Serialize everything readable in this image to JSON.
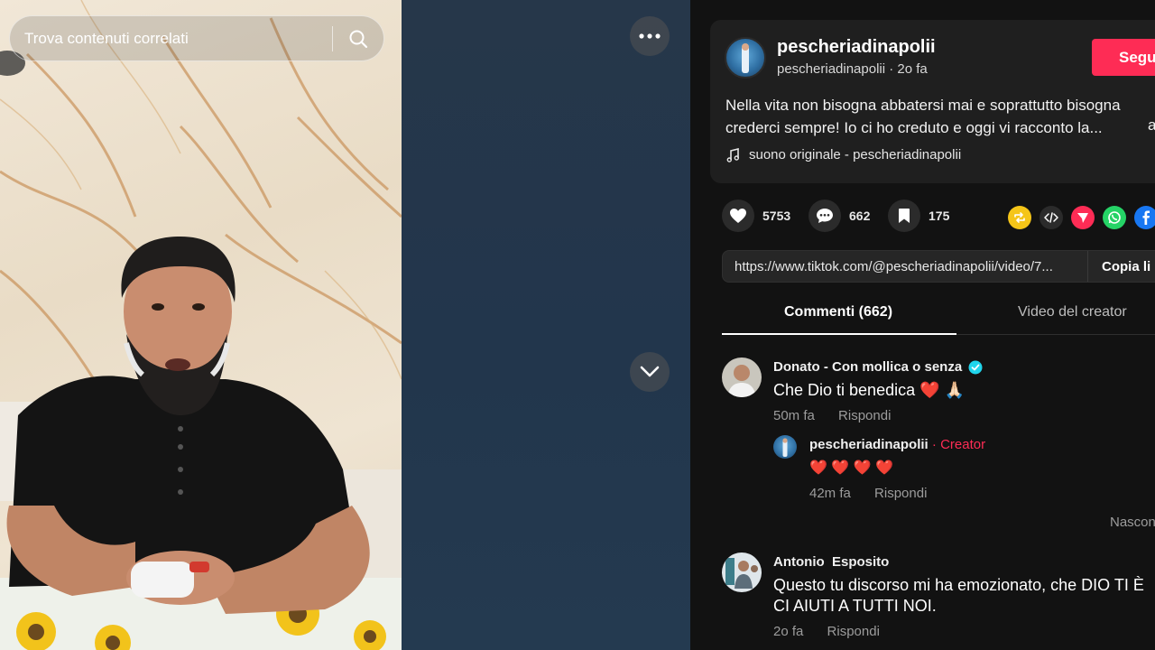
{
  "search": {
    "placeholder": "Trova contenuti correlati"
  },
  "post": {
    "author_name": "pescheriadinapolii",
    "author_sub": "pescheriadinapolii · 2o fa",
    "follow_label": "Segui",
    "description_line1": "Nella vita non bisogna abbatersi mai e soprattutto bisogna",
    "description_line2": "crederci sempre! Io ci ho creduto e oggi vi racconto la...",
    "description_more": "a",
    "music": "suono originale - pescheriadinapolii"
  },
  "actions": {
    "likes": "5753",
    "comments": "662",
    "saves": "175"
  },
  "share_colors": {
    "repost": "#f5c518",
    "embed": "#2b2b2b",
    "send": "#fe2c55",
    "whatsapp": "#25d366",
    "facebook": "#1877f2"
  },
  "link": {
    "url": "https://www.tiktok.com/@pescheriadinapolii/video/7...",
    "copy_label": "Copia li"
  },
  "tabs": {
    "comments": "Commenti (662)",
    "creator_videos": "Video del creator"
  },
  "comments": [
    {
      "user": "Donato - Con mollica o senza",
      "text": "Che Dio ti benedica ❤️ 🙏🏻",
      "time": "50m fa",
      "reply_label": "Rispondi"
    },
    {
      "user": "Antonio  Esposito",
      "text_line1": "Questo tu discorso mi ha emozionato, che DIO TI È",
      "text_line2": "CI AIUTI A TUTTI NOI.",
      "time": "2o fa",
      "reply_label": "Rispondi"
    }
  ],
  "reply": {
    "user": "pescheriadinapolii",
    "separator": " · ",
    "tag": "Creator",
    "text": "❤️ ❤️ ❤️ ❤️",
    "time": "42m fa",
    "reply_label": "Rispondi"
  },
  "hide_label": "Nascon"
}
